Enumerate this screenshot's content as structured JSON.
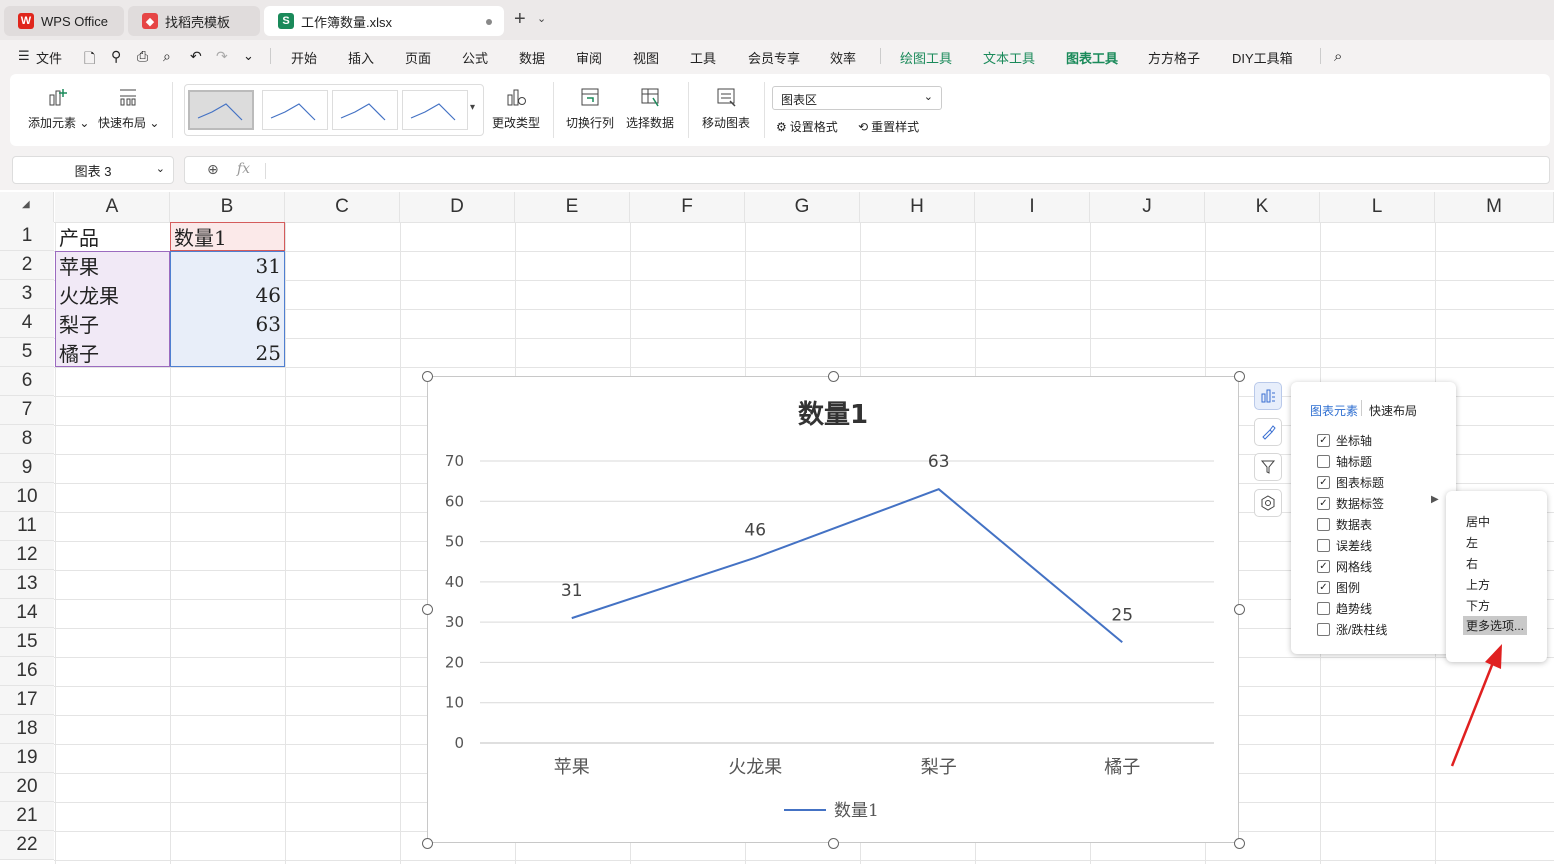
{
  "tabs": [
    {
      "label": "WPS Office",
      "logo": "W",
      "color": "#e0261c"
    },
    {
      "label": "找稻壳模板",
      "logo": "◆",
      "color": "#e64545"
    },
    {
      "label": "工作簿数量.xlsx",
      "logo": "S",
      "color": "#1a8a5a"
    }
  ],
  "menu": {
    "file": "文件",
    "items": [
      "开始",
      "插入",
      "页面",
      "公式",
      "数据",
      "审阅",
      "视图",
      "工具",
      "会员专享",
      "效率"
    ],
    "accent_items": [
      "绘图工具",
      "文本工具"
    ],
    "active_item": "图表工具",
    "extra_items": [
      "方方格子",
      "DIY工具箱"
    ]
  },
  "ribbon": {
    "add_element": "添加元素",
    "quick_layout": "快速布局",
    "change_type": "更改类型",
    "switch_rowcol": "切换行列",
    "select_data": "选择数据",
    "move_chart": "移动图表",
    "area_select": "图表区",
    "set_format": "设置格式",
    "reset_style": "重置样式"
  },
  "formula_bar": {
    "name_box": "图表 3",
    "fx": "fx",
    "content": ""
  },
  "columns": [
    "A",
    "B",
    "C",
    "D",
    "E",
    "F",
    "G",
    "H",
    "I",
    "J",
    "K",
    "L",
    "M"
  ],
  "rows": [
    "1",
    "2",
    "3",
    "4",
    "5",
    "6",
    "7",
    "8",
    "9",
    "10",
    "11",
    "12",
    "13",
    "14",
    "15",
    "16",
    "17",
    "18",
    "19",
    "20",
    "21",
    "22"
  ],
  "cells": {
    "a1": "产品",
    "b1": "数量1",
    "a2": "苹果",
    "b2": "31",
    "a3": "火龙果",
    "b3": "46",
    "a4": "梨子",
    "b4": "63",
    "a5": "橘子",
    "b5": "25"
  },
  "chart_data": {
    "type": "line",
    "title": "数量1",
    "categories": [
      "苹果",
      "火龙果",
      "梨子",
      "橘子"
    ],
    "series": [
      {
        "name": "数量1",
        "values": [
          31,
          46,
          63,
          25
        ],
        "color": "#4472c4"
      }
    ],
    "y_ticks": [
      "0",
      "10",
      "20",
      "30",
      "40",
      "50",
      "60",
      "70"
    ],
    "ylim": [
      0,
      70
    ],
    "data_labels": [
      "31",
      "46",
      "63",
      "25"
    ],
    "grid": true,
    "legend": "bottom"
  },
  "elements_panel": {
    "tab_elements": "图表元素",
    "tab_layout": "快速布局",
    "items": [
      {
        "label": "坐标轴",
        "checked": true
      },
      {
        "label": "轴标题",
        "checked": false
      },
      {
        "label": "图表标题",
        "checked": true
      },
      {
        "label": "数据标签",
        "checked": true
      },
      {
        "label": "数据表",
        "checked": false
      },
      {
        "label": "误差线",
        "checked": false
      },
      {
        "label": "网格线",
        "checked": true
      },
      {
        "label": "图例",
        "checked": true
      },
      {
        "label": "趋势线",
        "checked": false
      },
      {
        "label": "涨/跌柱线",
        "checked": false
      }
    ]
  },
  "label_submenu": {
    "items": [
      "居中",
      "左",
      "右",
      "上方",
      "下方",
      "更多选项..."
    ],
    "highlighted": "更多选项..."
  },
  "colors": {
    "accent": "#1a8a5a",
    "series": "#4472c4",
    "arrow": "#e02020"
  }
}
